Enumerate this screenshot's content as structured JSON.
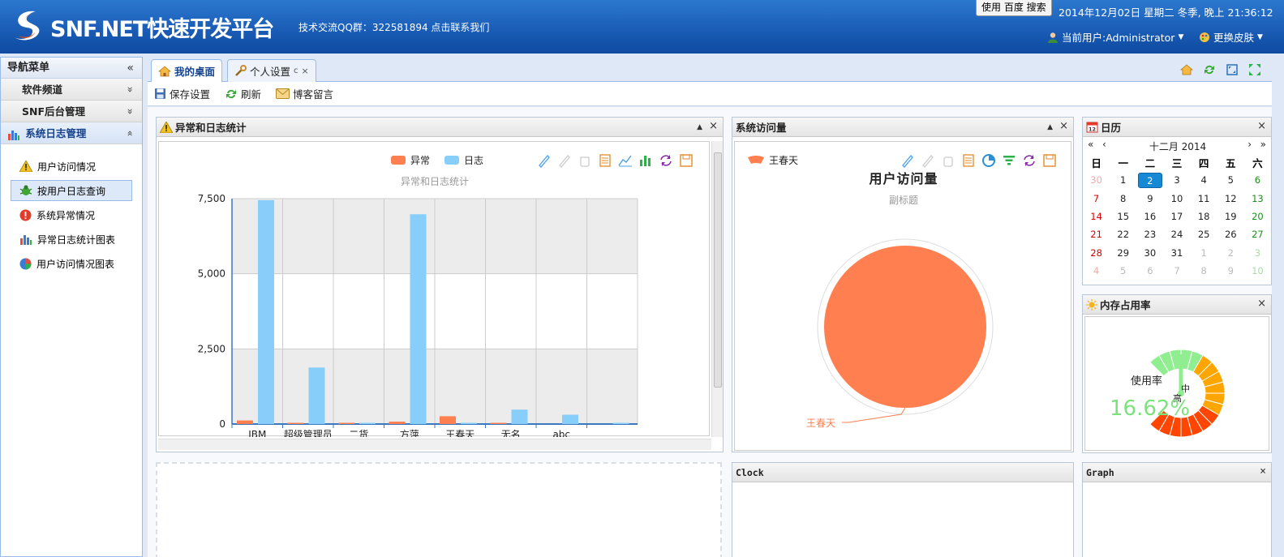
{
  "header": {
    "app_title": "SNF.NET快速开发平台",
    "qq_text": "技术交流QQ群：322581894 点击联系我们",
    "search_button": "使用 百度 搜索",
    "datetime": "2014年12月02日 星期二 冬季, 晚上 21:36:12",
    "current_user": "当前用户:Administrator",
    "skin_label": "更换皮肤"
  },
  "nav": {
    "title": "导航菜单",
    "collapse_glyph": "«",
    "groups": [
      {
        "label": "软件频道",
        "glyph": "»"
      },
      {
        "label": "SNF后台管理",
        "glyph": "»"
      },
      {
        "label": "系统日志管理",
        "glyph": "«"
      }
    ],
    "items": [
      {
        "label": "用户访问情况",
        "icon": "warning-icon"
      },
      {
        "label": "按用户日志查询",
        "icon": "bug-icon"
      },
      {
        "label": "系统异常情况",
        "icon": "error-icon"
      },
      {
        "label": "异常日志统计图表",
        "icon": "bar-chart-icon"
      },
      {
        "label": "用户访问情况图表",
        "icon": "pie-chart-icon"
      }
    ]
  },
  "tabs": [
    {
      "label": "我的桌面",
      "icon": "home-icon"
    },
    {
      "label": "个人设置",
      "icon": "wrench-icon",
      "refresh": "c",
      "close": "×"
    }
  ],
  "toolbar": {
    "save": "保存设置",
    "refresh": "刷新",
    "blog": "博客留言"
  },
  "panels": {
    "errors": {
      "title": "异常和日志统计"
    },
    "visits": {
      "title": "系统访问量"
    },
    "calendar": {
      "title": "日历"
    },
    "memory": {
      "title": "内存占用率"
    },
    "clock": {
      "title": "Clock"
    },
    "graph": {
      "title": "Graph"
    },
    "close": "×",
    "min": "▲"
  },
  "chart_data": [
    {
      "type": "bar",
      "title": "异常和日志统计",
      "categories": [
        "IBM",
        "超级管理员",
        "二货",
        "方萍",
        "王春天",
        "无名",
        "abc",
        ""
      ],
      "series": [
        {
          "name": "异常",
          "values": [
            120,
            40,
            20,
            80,
            260,
            20,
            0,
            0
          ],
          "color": "#ff7f50"
        },
        {
          "name": "日志",
          "values": [
            7450,
            1880,
            20,
            6980,
            30,
            480,
            310,
            20
          ],
          "color": "#87cefa"
        }
      ],
      "yticks": [
        "0",
        "2,500",
        "5,000",
        "7,500"
      ],
      "ylim": [
        0,
        7500
      ],
      "legend": "top"
    },
    {
      "type": "pie",
      "title": "用户访问量",
      "subtitle": "副标题",
      "slices": [
        {
          "name": "王春天",
          "value": 100,
          "color": "#ff7f50"
        }
      ],
      "legend": "top-left"
    },
    {
      "type": "gauge",
      "label": "使用率",
      "value_text": "16.62%",
      "value": 16.62,
      "zone_labels": [
        "中",
        "高"
      ]
    }
  ],
  "calendar": {
    "month_label": "十二月 2014",
    "nav": {
      "prev_year": "«",
      "prev": "‹",
      "next": "›",
      "next_year": "»"
    },
    "weekdays": [
      "日",
      "一",
      "二",
      "三",
      "四",
      "五",
      "六"
    ],
    "weeks": [
      [
        "30",
        "1",
        "2",
        "3",
        "4",
        "5",
        "6"
      ],
      [
        "7",
        "8",
        "9",
        "10",
        "11",
        "12",
        "13"
      ],
      [
        "14",
        "15",
        "16",
        "17",
        "18",
        "19",
        "20"
      ],
      [
        "21",
        "22",
        "23",
        "24",
        "25",
        "26",
        "27"
      ],
      [
        "28",
        "29",
        "30",
        "31",
        "1",
        "2",
        "3"
      ],
      [
        "4",
        "5",
        "6",
        "7",
        "8",
        "9",
        "10"
      ]
    ],
    "today": "2"
  }
}
